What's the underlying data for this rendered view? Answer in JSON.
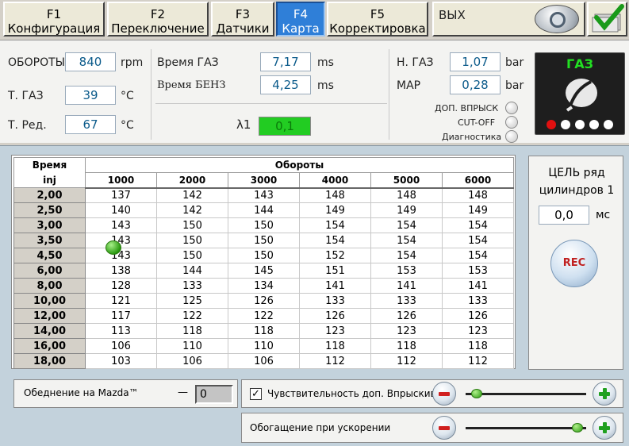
{
  "tabs": [
    {
      "key": "F1",
      "label": "Конфигурация"
    },
    {
      "key": "F2",
      "label": "Переключение"
    },
    {
      "key": "F3",
      "label": "Датчики"
    },
    {
      "key": "F4",
      "label": "Карта"
    },
    {
      "key": "F5",
      "label": "Корректировка"
    }
  ],
  "exit_label": "ВЫХ",
  "sensors": {
    "rpm_label": "ОБОРОТЫ",
    "rpm_value": "840",
    "rpm_unit": "rpm",
    "tgas_label": "Т. ГАЗ",
    "tgas_value": "39",
    "tgas_unit": "°C",
    "tred_label": "Т. Ред.",
    "tred_value": "67",
    "tred_unit": "°C",
    "time_gas_label": "Время ГАЗ",
    "time_gas_value": "7,17",
    "time_gas_unit": "ms",
    "time_benz_label": "Время БЕНЗ",
    "time_benz_value": "4,25",
    "time_benz_unit": "ms",
    "lambda_label": "λ1",
    "lambda_value": "0,1",
    "pgas_label": "Н. ГАЗ",
    "pgas_value": "1,07",
    "pgas_unit": "bar",
    "map_label": "MAP",
    "map_value": "0,28",
    "map_unit": "bar"
  },
  "indicators": [
    "ДОП. ВПРЫСК",
    "CUT-OFF",
    "Диагностика"
  ],
  "gas_panel_title": "ГАЗ",
  "status_colors": {
    "active": "#e01010",
    "inactive": "#ffffff",
    "lambda_bg": "#22cc22",
    "tab_active": "#2f7fd8"
  },
  "map_table": {
    "corner_top": "Время",
    "corner_bottom": "inj",
    "rpm_header": "Обороты",
    "columns": [
      "1000",
      "2000",
      "3000",
      "4000",
      "5000",
      "6000"
    ],
    "rows": [
      {
        "t": "2,00",
        "v": [
          "137",
          "142",
          "143",
          "148",
          "148",
          "148"
        ]
      },
      {
        "t": "2,50",
        "v": [
          "140",
          "142",
          "144",
          "149",
          "149",
          "149"
        ]
      },
      {
        "t": "3,00",
        "v": [
          "143",
          "150",
          "150",
          "154",
          "154",
          "154"
        ]
      },
      {
        "t": "3,50",
        "v": [
          "143",
          "150",
          "150",
          "154",
          "154",
          "154"
        ]
      },
      {
        "t": "4,50",
        "v": [
          "143",
          "150",
          "150",
          "152",
          "154",
          "154"
        ]
      },
      {
        "t": "6,00",
        "v": [
          "138",
          "144",
          "145",
          "151",
          "153",
          "153"
        ]
      },
      {
        "t": "8,00",
        "v": [
          "128",
          "133",
          "134",
          "141",
          "141",
          "141"
        ]
      },
      {
        "t": "10,00",
        "v": [
          "121",
          "125",
          "126",
          "133",
          "133",
          "133"
        ]
      },
      {
        "t": "12,00",
        "v": [
          "117",
          "122",
          "122",
          "126",
          "126",
          "126"
        ]
      },
      {
        "t": "14,00",
        "v": [
          "113",
          "118",
          "118",
          "123",
          "123",
          "123"
        ]
      },
      {
        "t": "16,00",
        "v": [
          "106",
          "110",
          "110",
          "118",
          "118",
          "118"
        ]
      },
      {
        "t": "18,00",
        "v": [
          "103",
          "106",
          "106",
          "112",
          "112",
          "112"
        ]
      }
    ]
  },
  "target": {
    "title": "ЦЕЛЬ ряд цилиндров 1",
    "value": "0,0",
    "unit": "мс",
    "rec_label": "REC"
  },
  "bottom": {
    "mazda_label": "Обеднение на Mazda™",
    "mazda_dash": "—",
    "mazda_value": "0",
    "sensitivity_label": "Чувствительность доп. Впрыскив.",
    "sensitivity_checked": "✓",
    "sensitivity_level": 0.05,
    "enrich_label": "Обогащение при ускорении",
    "enrich_level": 0.97
  }
}
